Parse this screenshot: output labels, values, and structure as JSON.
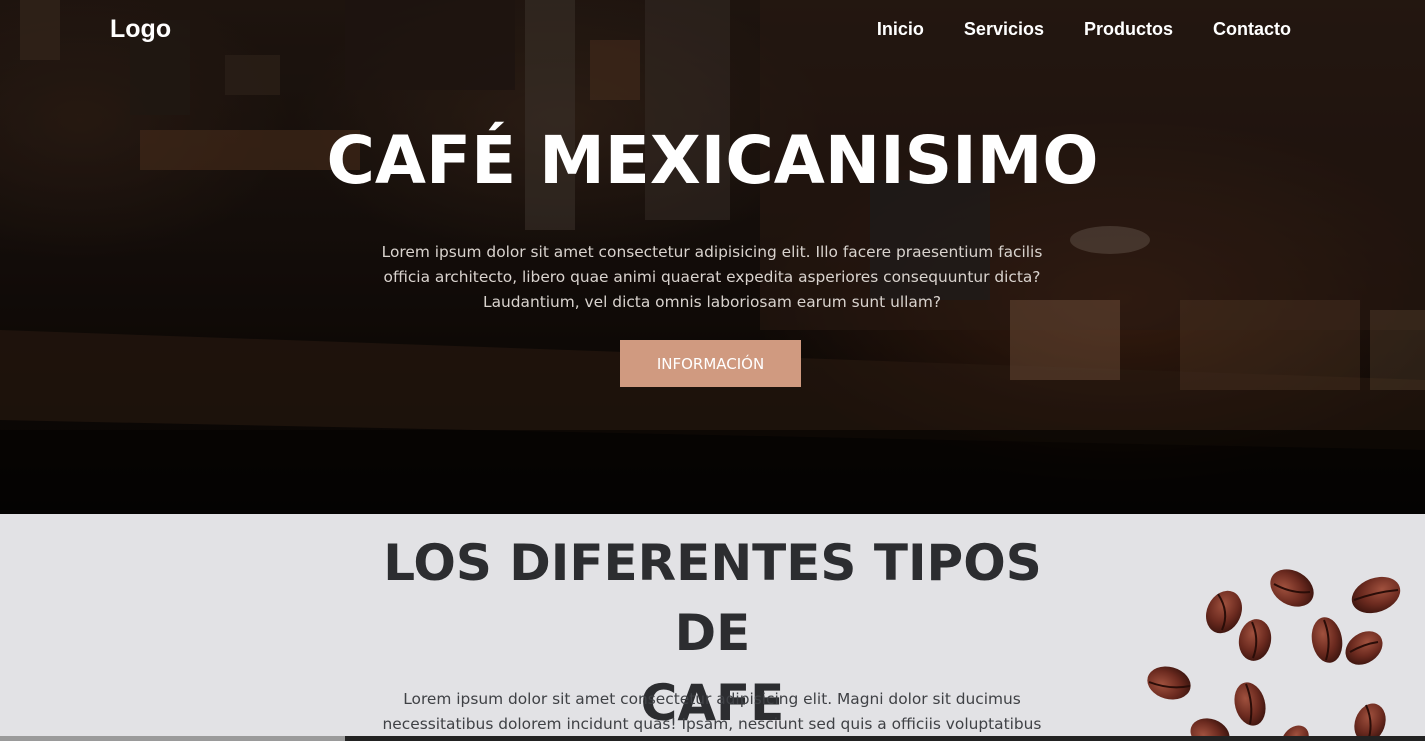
{
  "nav": {
    "logo": "Logo",
    "links": [
      "Inicio",
      "Servicios",
      "Productos",
      "Contacto"
    ]
  },
  "hero": {
    "title": "CAFÉ MEXICANISIMO",
    "text_lines": [
      "Lorem ipsum dolor sit amet consectetur adipisicing elit. Illo facere praesentium facilis",
      "officia architecto, libero quae animi quaerat expedita asperiores consequuntur dicta?",
      "Laudantium, vel dicta omnis laboriosam earum sunt ullam?"
    ],
    "button_label": "INFORMACIÓN"
  },
  "section": {
    "title_lines": [
      "LOS DIFERENTES TIPOS DE",
      "CAFE"
    ],
    "text_lines": [
      "Lorem ipsum dolor sit amet consectetur adipisicing elit. Magni dolor sit ducimus",
      "necessitatibus dolorem incidunt quas! Ipsam, nesciunt sed quis a officiis voluptatibus"
    ]
  },
  "colors": {
    "accent_button": "#d09a80",
    "section_bg": "#e2e2e5",
    "heading_dark": "#2c2d30"
  }
}
